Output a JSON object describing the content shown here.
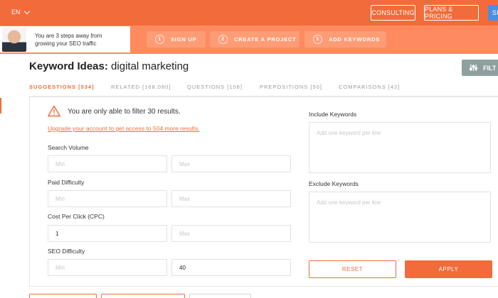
{
  "header": {
    "language": "EN",
    "nav": {
      "consulting": "CONSULTING",
      "plans": "PLANS & PRICING",
      "signin": "SI"
    }
  },
  "promo": {
    "text": "You are 3 steps away from growing your SEO traffic"
  },
  "steps": [
    {
      "num": "1",
      "label": "SIGN UP"
    },
    {
      "num": "2",
      "label": "CREATE A PROJECT"
    },
    {
      "num": "3",
      "label": "ADD KEYWORDS"
    }
  ],
  "page": {
    "title_prefix": "Keyword Ideas:",
    "title_query": "digital marketing",
    "filter_button": "FILT"
  },
  "tabs": [
    {
      "label": "SUGGESTIONS [534]"
    },
    {
      "label": "RELATED [168,080]"
    },
    {
      "label": "QUESTIONS [108]"
    },
    {
      "label": "PREPOSITIONS [50]"
    },
    {
      "label": "COMPARISONS [42]"
    }
  ],
  "filters": {
    "warning": "You are only able to filter 30 results.",
    "upgrade_link": "Upgrade your account to get access to 504 more results.",
    "search_volume": {
      "label": "Search Volume",
      "min_placeholder": "Min",
      "max_placeholder": "Max",
      "min": "",
      "max": ""
    },
    "paid_difficulty": {
      "label": "Paid Difficulty",
      "min_placeholder": "Min",
      "max_placeholder": "Max",
      "min": "",
      "max": ""
    },
    "cpc": {
      "label": "Cost Per Click (CPC)",
      "min_placeholder": "",
      "max_placeholder": "Max",
      "min": "1",
      "max": ""
    },
    "seo_difficulty": {
      "label": "SEO Difficulty",
      "min_placeholder": "Min",
      "max_placeholder": "",
      "min": "",
      "max": "40"
    },
    "include": {
      "label": "Include Keywords",
      "placeholder": "Add one keyword per line"
    },
    "exclude": {
      "label": "Exclude Keywords",
      "placeholder": "Add one keyword per line"
    },
    "reset": "RESET",
    "apply": "APPLY"
  },
  "colors": {
    "primary": "#f26b3a",
    "steps_bg": "#fd8b5f",
    "filter_btn": "#8f9fa0",
    "signin": "#4a90e2"
  }
}
